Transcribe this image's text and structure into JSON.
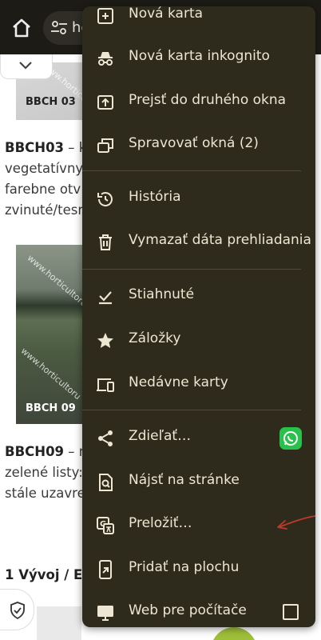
{
  "browser": {
    "url_fragment": "he"
  },
  "page": {
    "img1_caption": "BBCH 03",
    "para1_lines": [
      "vegetatívny",
      "farebne otv",
      "zvinuté/tesr"
    ],
    "para1_bold": "BBCH03",
    "para1_rest": " – k",
    "img2_caption": "BBCH 09",
    "watermark": "www.horticultoru",
    "para2_bold": "BBCH09",
    "para2_rest": " – n",
    "para2_lines": [
      "zelené listy:",
      "stále uzavre"
    ],
    "heading": "1 Vývoj / Ev"
  },
  "menu": {
    "items": [
      {
        "label": "Nová karta",
        "icon": "new-tab-icon"
      },
      {
        "label": "Nová karta inkognito",
        "icon": "incognito-icon"
      },
      {
        "label": "Prejsť do druhého okna",
        "icon": "move-window-icon"
      },
      {
        "label": "Spravovať okná (2)",
        "icon": "manage-windows-icon"
      },
      {
        "label": "História",
        "icon": "history-icon"
      },
      {
        "label": "Vymazať dáta prehliadania",
        "icon": "trash-icon"
      },
      {
        "label": "Stiahnuté",
        "icon": "download-check-icon"
      },
      {
        "label": "Záložky",
        "icon": "star-icon"
      },
      {
        "label": "Nedávne karty",
        "icon": "devices-icon"
      },
      {
        "label": "Zdieľať…",
        "icon": "share-icon"
      },
      {
        "label": "Nájsť na stránke",
        "icon": "find-in-page-icon"
      },
      {
        "label": "Preložiť…",
        "icon": "translate-icon"
      },
      {
        "label": "Pridať na plochu",
        "icon": "add-to-home-icon"
      },
      {
        "label": "Web pre počítače",
        "icon": "desktop-icon"
      }
    ]
  },
  "colors": {
    "menu_bg": "#2f2b1c",
    "menu_text": "#ece6d2",
    "whatsapp": "#29c14c",
    "annotation_arrow": "#c0392b"
  }
}
